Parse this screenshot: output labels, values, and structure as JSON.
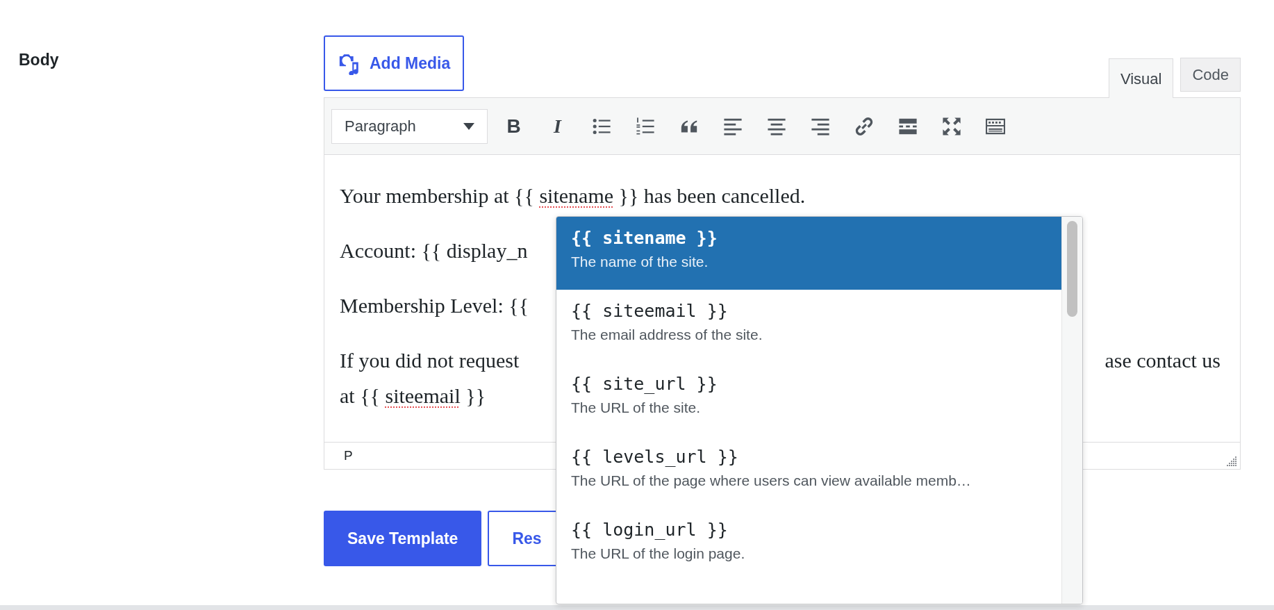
{
  "field_label": "Body",
  "add_media_button": {
    "label": "Add Media"
  },
  "editor_tabs": [
    {
      "label": "Visual",
      "selected": true
    },
    {
      "label": "Code",
      "selected": false
    }
  ],
  "toolbar": {
    "format_select": "Paragraph",
    "buttons": [
      {
        "kind": "bold",
        "glyph": "B"
      },
      {
        "kind": "italic",
        "glyph": "I"
      },
      {
        "kind": "bullet-list"
      },
      {
        "kind": "numbered-list"
      },
      {
        "kind": "quote"
      },
      {
        "kind": "align-left"
      },
      {
        "kind": "align-center"
      },
      {
        "kind": "align-right"
      },
      {
        "kind": "link"
      },
      {
        "kind": "read-more"
      },
      {
        "kind": "fullscreen"
      },
      {
        "kind": "toolbar-toggle"
      }
    ]
  },
  "paragraphs": [
    {
      "lines": [
        {
          "left": [
            {
              "text": "Your membership at {{ ",
              "misspelled": false
            },
            {
              "text": "sitename",
              "misspelled": true
            },
            {
              "text": " }} has been cancelled.",
              "misspelled": false
            }
          ]
        }
      ]
    },
    {
      "lines": [
        {
          "left": [
            {
              "text": "Account: {{ display_n",
              "misspelled": false
            }
          ]
        }
      ]
    },
    {
      "lines": [
        {
          "left": [
            {
              "text": "Membership Level: {{",
              "misspelled": false
            }
          ]
        }
      ]
    },
    {
      "lines": [
        {
          "left": [
            {
              "text": "If you did not request",
              "misspelled": false
            }
          ],
          "right": [
            {
              "text": "ase contact us",
              "misspelled": false
            }
          ]
        },
        {
          "left": [
            {
              "text": "at {{ ",
              "misspelled": false
            },
            {
              "text": "siteemail",
              "misspelled": true
            },
            {
              "text": " }}",
              "misspelled": false
            }
          ]
        }
      ]
    }
  ],
  "status_path": "P",
  "actions": [
    {
      "label": "Save Template",
      "kind": "primary"
    },
    {
      "label": "Res",
      "kind": "secondary"
    }
  ],
  "autocomplete": {
    "items": [
      {
        "tag": "{{ sitename }}",
        "description": "The name of the site.",
        "selected": true
      },
      {
        "tag": "{{ siteemail }}",
        "description": "The email address of the site.",
        "selected": false
      },
      {
        "tag": "{{ site_url }}",
        "description": "The URL of the site.",
        "selected": false
      },
      {
        "tag": "{{ levels_url }}",
        "description": "The URL of the page where users can view available memb…",
        "selected": false
      },
      {
        "tag": "{{ login_url }}",
        "description": "The URL of the login page.",
        "selected": false
      }
    ]
  }
}
